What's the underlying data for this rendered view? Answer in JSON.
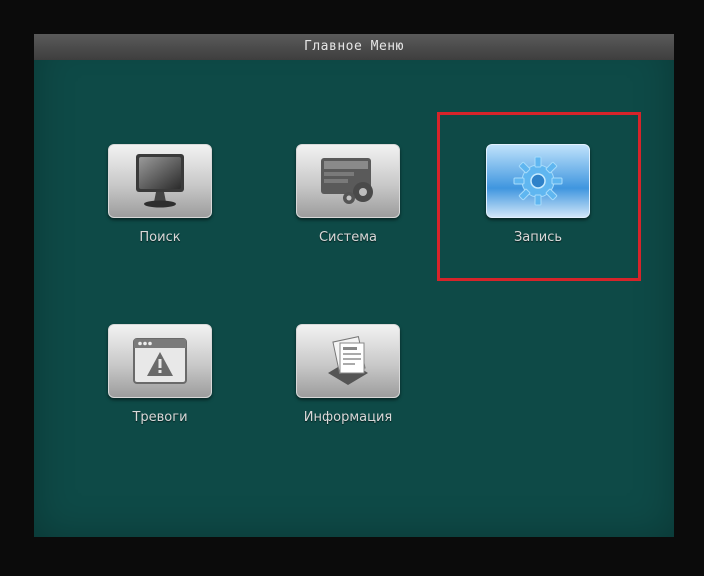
{
  "window": {
    "title": "Главное Меню"
  },
  "menu": {
    "items": [
      {
        "id": "search",
        "label": "Поиск",
        "icon": "monitor-icon"
      },
      {
        "id": "system",
        "label": "Система",
        "icon": "system-settings-icon"
      },
      {
        "id": "record",
        "label": "Запись",
        "icon": "gear-icon",
        "selected": true
      },
      {
        "id": "alarms",
        "label": "Тревоги",
        "icon": "warning-window-icon"
      },
      {
        "id": "info",
        "label": "Информация",
        "icon": "documents-icon"
      }
    ]
  },
  "colors": {
    "background": "#0e4a47",
    "titlebar": "#4a4a4a",
    "selected_tile": "#3f96df",
    "highlight_frame": "#d6242a"
  }
}
